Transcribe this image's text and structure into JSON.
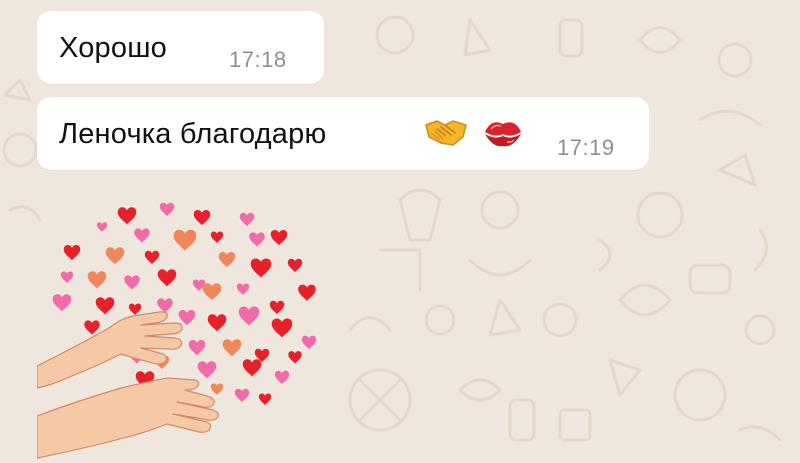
{
  "messages": [
    {
      "text": "Хорошо",
      "time": "17:18",
      "emojis": []
    },
    {
      "text": "Леночка благодарю",
      "time": "17:19",
      "emojis": [
        "handshake-emoji",
        "kiss-mark-emoji"
      ]
    }
  ],
  "sticker": {
    "name": "hands-with-hearts-sticker"
  },
  "colors": {
    "chat_background": "#efe7de",
    "bubble": "#ffffff",
    "message_text": "#111111",
    "timestamp": "#8e8e8e",
    "heart_red": "#e8202a",
    "heart_pink": "#f26aa8",
    "heart_orange": "#f0875a",
    "skin": "#f6c9a6"
  }
}
